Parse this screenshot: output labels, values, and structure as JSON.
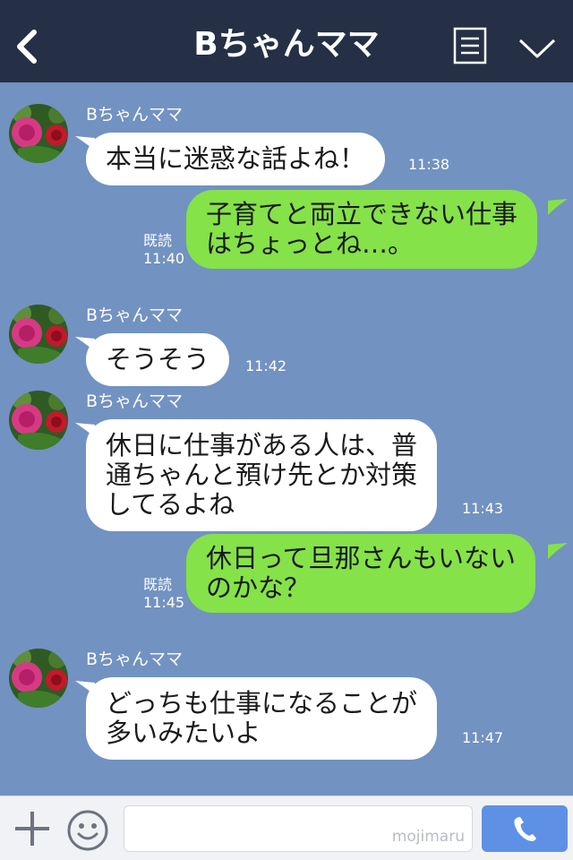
{
  "header": {
    "title": "Bちゃんママ"
  },
  "messages": [
    {
      "side": "in",
      "sender": "Bちゃんママ",
      "text": "本当に迷惑な話よね！",
      "time": "11:38"
    },
    {
      "side": "out",
      "text": "子育てと両立できない仕事\nはちょっとね…。",
      "read": "既読",
      "time": "11:40"
    },
    {
      "side": "in",
      "sender": "Bちゃんママ",
      "text": "そうそう",
      "time": "11:42"
    },
    {
      "side": "in",
      "sender": "Bちゃんママ",
      "text": "休日に仕事がある人は、普\n通ちゃんと預け先とか対策\nしてるよね",
      "time": "11:43"
    },
    {
      "side": "out",
      "text": "休日って旦那さんもいない\nのかな？",
      "read": "既読",
      "time": "11:45"
    },
    {
      "side": "in",
      "sender": "Bちゃんママ",
      "text": "どっちも仕事になることが\n多いみたいよ",
      "time": "11:47"
    }
  ],
  "footer": {
    "watermark": "mojimaru"
  },
  "colors": {
    "header_bg": "#253046",
    "chat_bg": "#7292c1",
    "outgoing_bubble": "#85e249",
    "incoming_bubble": "#ffffff",
    "call_button": "#5e91e6"
  }
}
